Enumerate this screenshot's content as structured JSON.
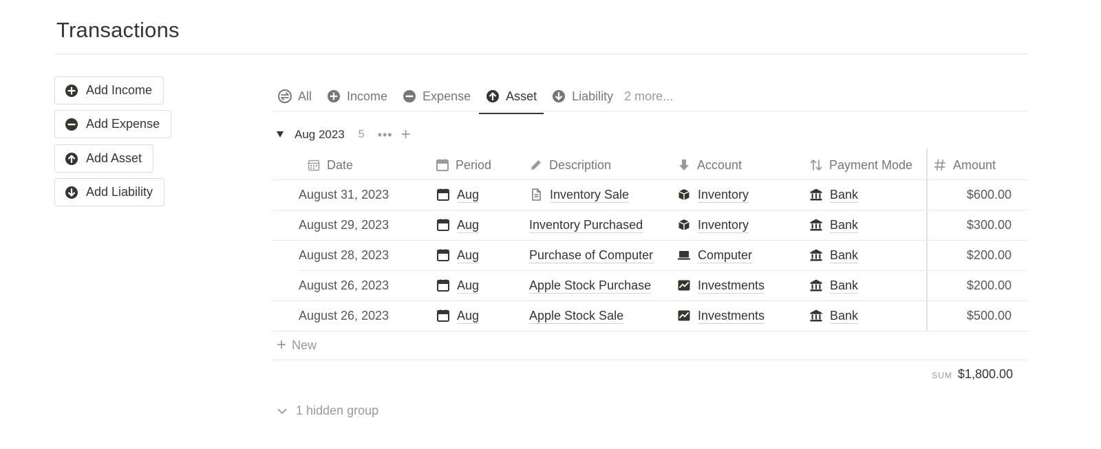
{
  "page": {
    "title": "Transactions"
  },
  "sidebar_buttons": [
    {
      "label": "Add Income",
      "icon": "plus-circle-icon"
    },
    {
      "label": "Add Expense",
      "icon": "minus-circle-icon"
    },
    {
      "label": "Add Asset",
      "icon": "arrow-up-circle-icon"
    },
    {
      "label": "Add Liability",
      "icon": "arrow-down-circle-icon"
    }
  ],
  "tabs": [
    {
      "label": "All",
      "icon": "arrows-exchange-icon",
      "active": false
    },
    {
      "label": "Income",
      "icon": "plus-circle-icon",
      "active": false
    },
    {
      "label": "Expense",
      "icon": "minus-circle-icon",
      "active": false
    },
    {
      "label": "Asset",
      "icon": "arrow-up-circle-icon",
      "active": true
    },
    {
      "label": "Liability",
      "icon": "arrow-down-circle-icon",
      "active": false
    }
  ],
  "more_tabs": "2 more...",
  "group": {
    "label": "Aug 2023",
    "count": "5",
    "more": "•••",
    "add": "+"
  },
  "columns": {
    "date": "Date",
    "period": "Period",
    "description": "Description",
    "account": "Account",
    "payment_mode": "Payment Mode",
    "amount": "Amount"
  },
  "rows": [
    {
      "date": "August 31, 2023",
      "period": "Aug",
      "description": "Inventory Sale",
      "description_icon": "page-icon",
      "account": "Inventory",
      "account_icon": "box-icon",
      "payment_mode": "Bank",
      "amount": "$600.00"
    },
    {
      "date": "August 29, 2023",
      "period": "Aug",
      "description": "Inventory Purchased",
      "description_icon": "",
      "account": "Inventory",
      "account_icon": "box-icon",
      "payment_mode": "Bank",
      "amount": "$300.00"
    },
    {
      "date": "August 28, 2023",
      "period": "Aug",
      "description": "Purchase of Computer",
      "description_icon": "",
      "account": "Computer",
      "account_icon": "laptop-icon",
      "payment_mode": "Bank",
      "amount": "$200.00"
    },
    {
      "date": "August 26, 2023",
      "period": "Aug",
      "description": "Apple Stock Purchase",
      "description_icon": "",
      "account": "Investments",
      "account_icon": "chart-icon",
      "payment_mode": "Bank",
      "amount": "$200.00"
    },
    {
      "date": "August 26, 2023",
      "period": "Aug",
      "description": "Apple Stock Sale",
      "description_icon": "",
      "account": "Investments",
      "account_icon": "chart-icon",
      "payment_mode": "Bank",
      "amount": "$500.00"
    }
  ],
  "new_label": "New",
  "sum": {
    "label": "SUM",
    "value": "$1,800.00"
  },
  "hidden_groups": "1 hidden group",
  "colors": {
    "text": "#37352f",
    "muted": "#787774",
    "faint": "#9b9a97",
    "border": "#e9e9e7"
  }
}
